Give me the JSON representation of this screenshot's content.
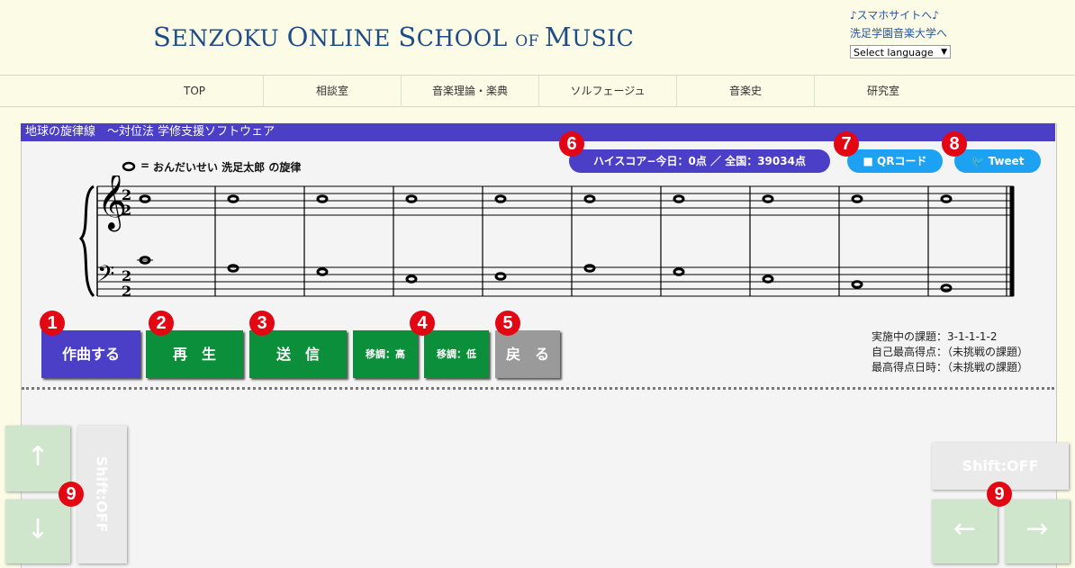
{
  "header": {
    "logo": {
      "p1": "S",
      "p2": "ENZOKU ",
      "p3": "O",
      "p4": "NLINE ",
      "p5": "S",
      "p6": "CHOOL ",
      "p7": "OF ",
      "p8": "M",
      "p9": "USIC"
    },
    "links": [
      "♪スマホサイトへ♪",
      "洗足学園音楽大学へ"
    ],
    "language_select": "Select language"
  },
  "nav": [
    "TOP",
    "相談室",
    "音楽理論・楽典",
    "ソルフェージュ",
    "音楽史",
    "研究室"
  ],
  "panel": {
    "title": "地球の旋律線　～対位法 学修支援ソフトウェア",
    "legend_prefix": "=",
    "legend_text": "おんだいせい 洗足太郎 の旋律",
    "high_score": "ハイスコア−今日：0点 ／ 全国：39034点",
    "qr_label": "QRコード",
    "tweet_label": "Tweet",
    "time_signature": {
      "top": "2",
      "bottom": "2"
    }
  },
  "buttons": {
    "compose": "作曲する",
    "play": "再　生",
    "send": "送　信",
    "transpose_up": "移調：高",
    "transpose_down": "移調：低",
    "back": "戻　る"
  },
  "badges": [
    "1",
    "2",
    "3",
    "4",
    "5",
    "6",
    "7",
    "8",
    "9",
    "9"
  ],
  "status": {
    "task": "実施中の課題：3-1-1-1-2",
    "best_score": "自己最高得点：（未挑戦の課題）",
    "best_time": "最高得点日時：（未挑戦の課題）"
  },
  "controls": {
    "up": "↑",
    "down": "↓",
    "left": "←",
    "right": "→",
    "shift_left": "Shift:OFF",
    "shift_right": "Shift:OFF"
  },
  "colors": {
    "accent": "#4b3ec7",
    "green": "#0c8f3a",
    "badge": "#e30613",
    "sky": "#1da1f2"
  }
}
